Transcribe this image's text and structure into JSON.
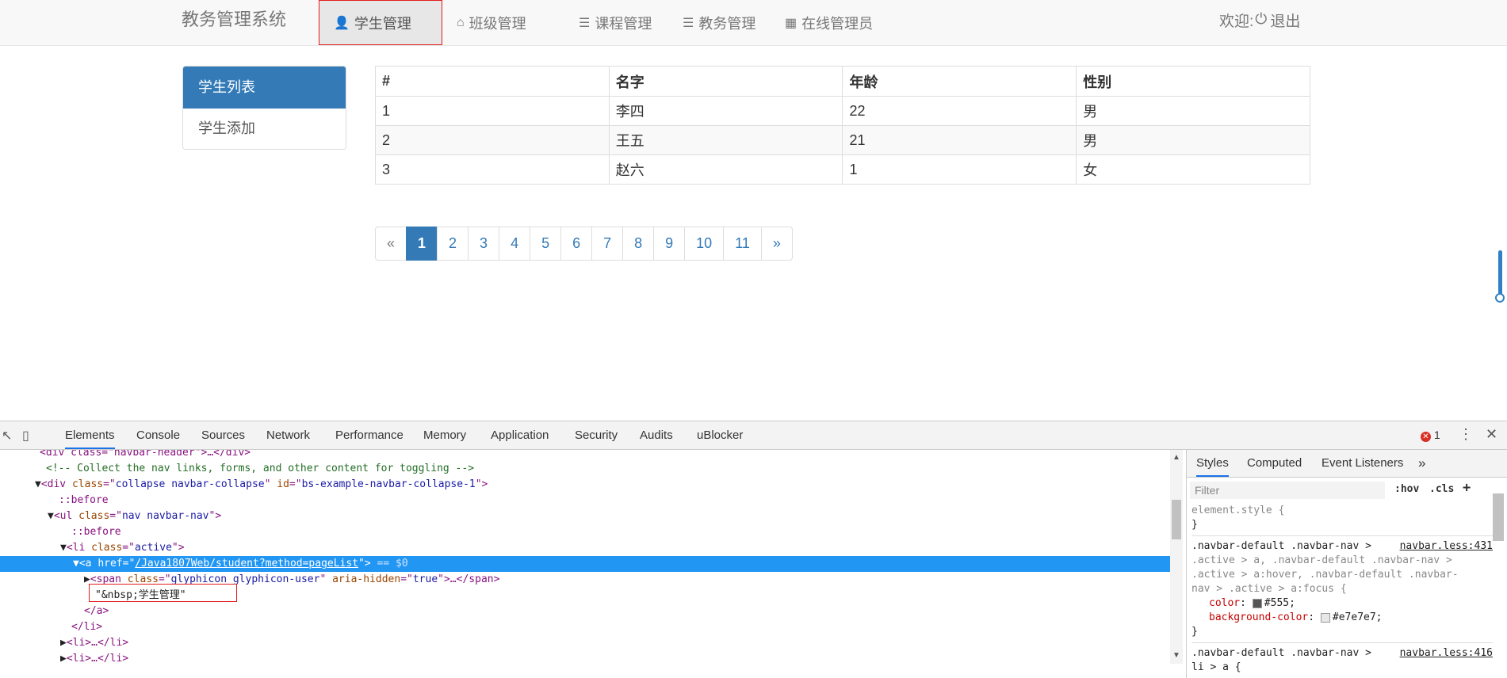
{
  "navbar": {
    "brand": "教务管理系统",
    "items": [
      {
        "icon": "user-icon",
        "glyph": "👤",
        "label": "学生管理"
      },
      {
        "icon": "home-icon",
        "glyph": "⌂",
        "label": "班级管理"
      },
      {
        "icon": "list-icon",
        "glyph": "☰",
        "label": "课程管理"
      },
      {
        "icon": "list-icon",
        "glyph": "☰",
        "label": "教务管理"
      },
      {
        "icon": "calendar-icon",
        "glyph": "▦",
        "label": "在线管理员"
      }
    ],
    "welcome": "欢迎:",
    "logout": "退出"
  },
  "sidebar": {
    "items": [
      {
        "label": "学生列表"
      },
      {
        "label": "学生添加"
      }
    ]
  },
  "table": {
    "headers": [
      "#",
      "名字",
      "年龄",
      "性别"
    ],
    "rows": [
      [
        "1",
        "李四",
        "22",
        "男"
      ],
      [
        "2",
        "王五",
        "21",
        "男"
      ],
      [
        "3",
        "赵六",
        "1",
        "女"
      ]
    ]
  },
  "pagination": {
    "prev": "«",
    "pages": [
      "1",
      "2",
      "3",
      "4",
      "5",
      "6",
      "7",
      "8",
      "9",
      "10",
      "11"
    ],
    "next": "»",
    "current": "1"
  },
  "devtools": {
    "tabs": [
      "Elements",
      "Console",
      "Sources",
      "Network",
      "Performance",
      "Memory",
      "Application",
      "Security",
      "Audits",
      "uBlocker"
    ],
    "error_count": "1",
    "dom": {
      "l0": "<div class=\"navbar-header\">…</div>",
      "comment": "<!-- Collect the nav links, forms, and other content for toggling -->",
      "div_tag": "div",
      "div_class": "collapse navbar-collapse",
      "div_id": "bs-example-navbar-collapse-1",
      "before": "::before",
      "ul_class": "nav navbar-nav",
      "li_class": "active",
      "a_href": "/Java1807Web/student?method=pageList",
      "eq0": "== $0",
      "span_class": "glyphicon glyphicon-user",
      "span_aria": "true",
      "text_node": "\"&nbsp;学生管理\"",
      "close_a": "</a>",
      "close_li": "</li>",
      "li_collapsed": "<li>…</li>"
    },
    "styles": {
      "tabs": [
        "Styles",
        "Computed",
        "Event Listeners"
      ],
      "filter_placeholder": "Filter",
      "hov": ":hov",
      "cls": ".cls",
      "element_style": "element.style {",
      "close_brace": "}",
      "rule1_sel_a": ".navbar-default .navbar-nav >",
      "rule1_link": "navbar.less:431",
      "rule1_sel_b": ".active > a, .navbar-default .navbar-nav >",
      "rule1_sel_c": ".active > a:hover, .navbar-default .navbar-",
      "rule1_sel_d": "nav > .active > a:focus {",
      "color_prop": "color",
      "color_val": "#555;",
      "bg_prop": "background-color",
      "bg_val": "#e7e7e7;",
      "rule2_sel": ".navbar-default .navbar-nav >",
      "rule2_link": "navbar.less:416",
      "rule2_sel_b": "li > a {"
    },
    "colors": {
      "swatch_555": "#555555",
      "swatch_e7e7e7": "#e7e7e7"
    }
  }
}
